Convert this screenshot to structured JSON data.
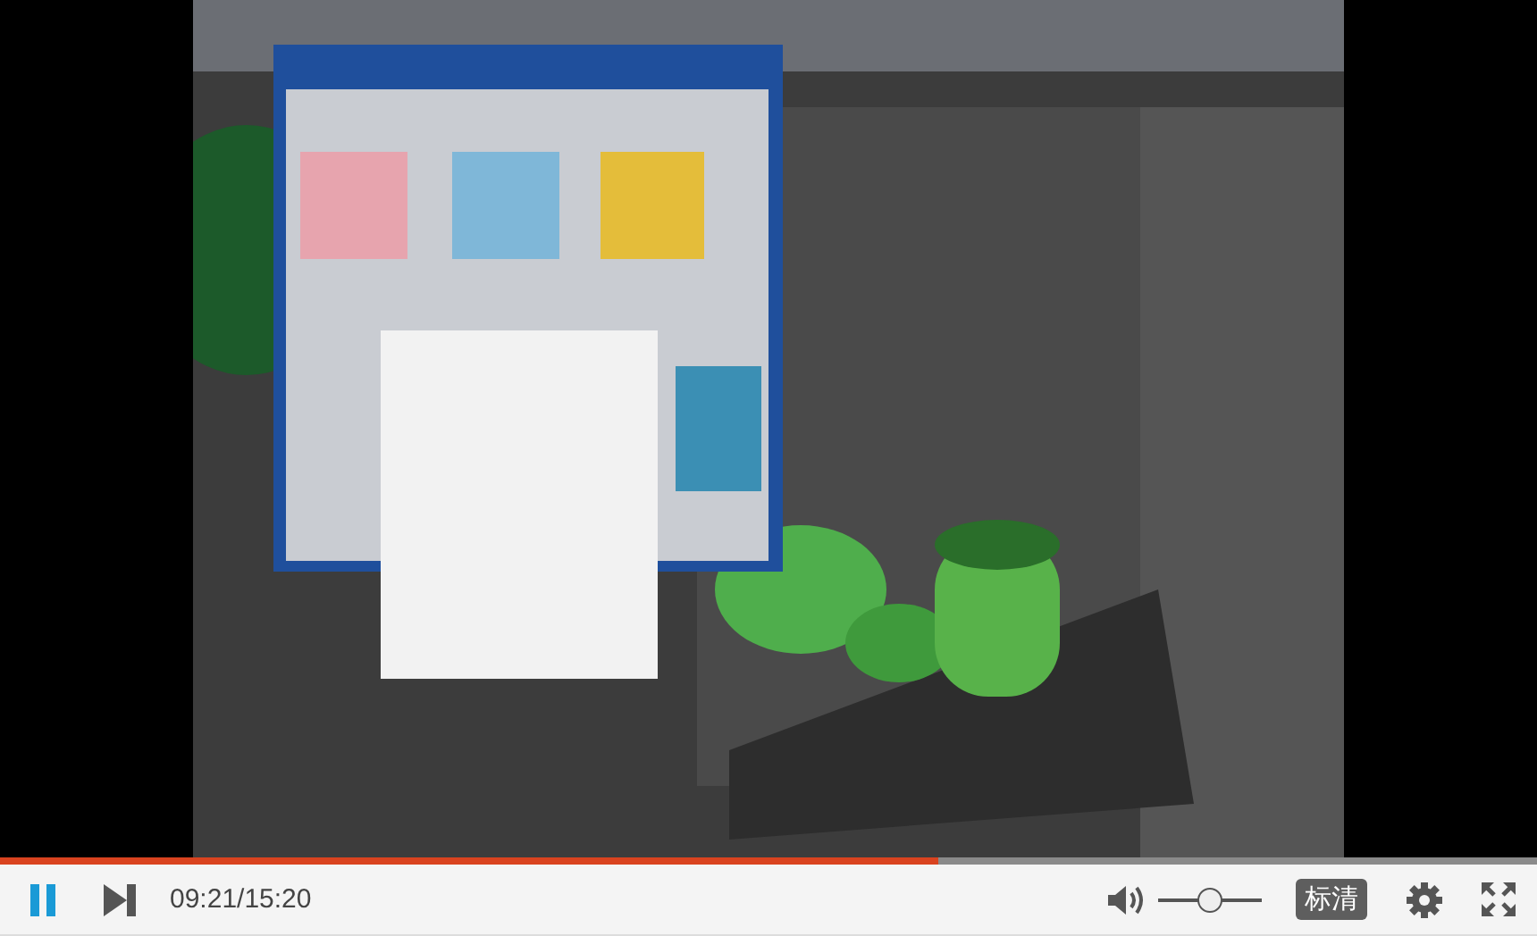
{
  "progress": {
    "level": 0.61
  },
  "controls": {
    "playing": true,
    "time": "09:21/15:20",
    "volume": {
      "level": 0.5
    },
    "quality": "标清"
  }
}
